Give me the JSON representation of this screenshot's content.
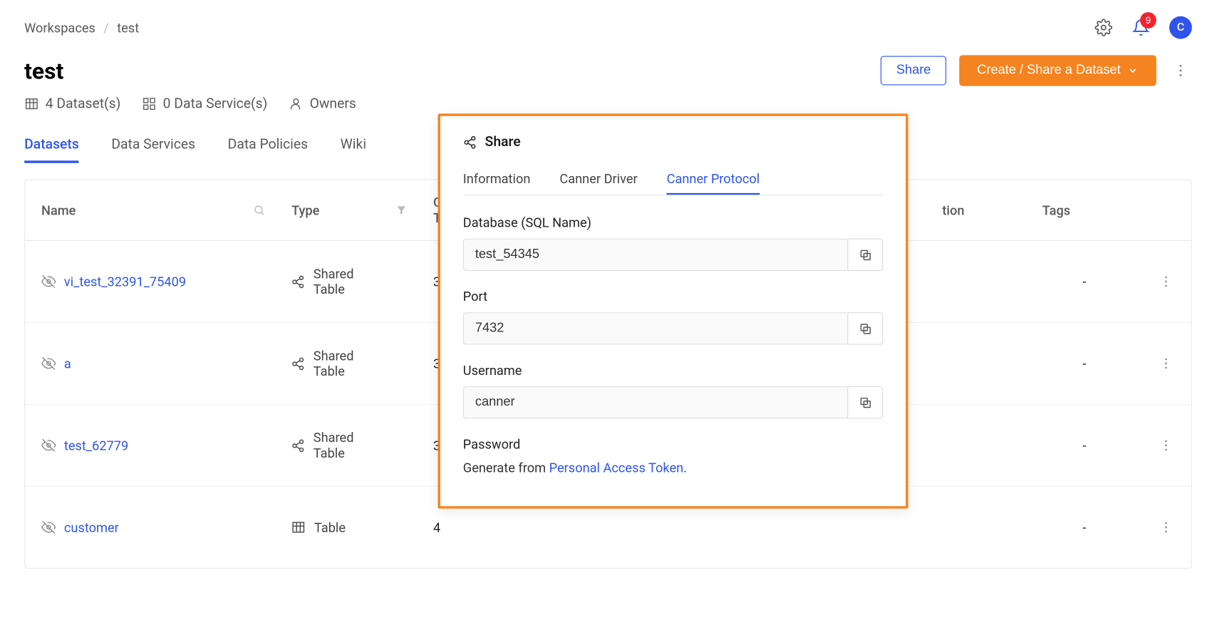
{
  "breadcrumb": {
    "root": "Workspaces",
    "current": "test"
  },
  "topbar": {
    "notification_count": "9",
    "avatar_initial": "C"
  },
  "header": {
    "title": "test",
    "share_label": "Share",
    "create_label": "Create / Share a Dataset"
  },
  "meta": {
    "datasets": "4 Dataset(s)",
    "services": "0 Data Service(s)",
    "owners": "Owners"
  },
  "tabs": {
    "datasets": "Datasets",
    "data_services": "Data Services",
    "data_policies": "Data Policies",
    "wiki": "Wiki"
  },
  "table": {
    "headers": {
      "name": "Name",
      "type": "Type",
      "col3": "C",
      "col3b": "T",
      "desc": "tion",
      "tags": "Tags"
    },
    "rows": [
      {
        "name": "vi_test_32391_75409",
        "type": "Shared Table",
        "c3": "3",
        "tags": "-"
      },
      {
        "name": "a",
        "type": "Shared Table",
        "c3": "3",
        "tags": "-"
      },
      {
        "name": "test_62779",
        "type": "Shared Table",
        "c3": "3",
        "tags": "-"
      },
      {
        "name": "customer",
        "type": "Table",
        "c3": "4",
        "tags": "-"
      }
    ]
  },
  "popup": {
    "title": "Share",
    "tabs": {
      "info": "Information",
      "driver": "Canner Driver",
      "protocol": "Canner Protocol"
    },
    "db_label": "Database (SQL Name)",
    "db_value": "test_54345",
    "port_label": "Port",
    "port_value": "7432",
    "user_label": "Username",
    "user_value": "canner",
    "password_label": "Password",
    "password_prefix": "Generate from ",
    "password_link": "Personal Access Token",
    "password_suffix": "."
  }
}
